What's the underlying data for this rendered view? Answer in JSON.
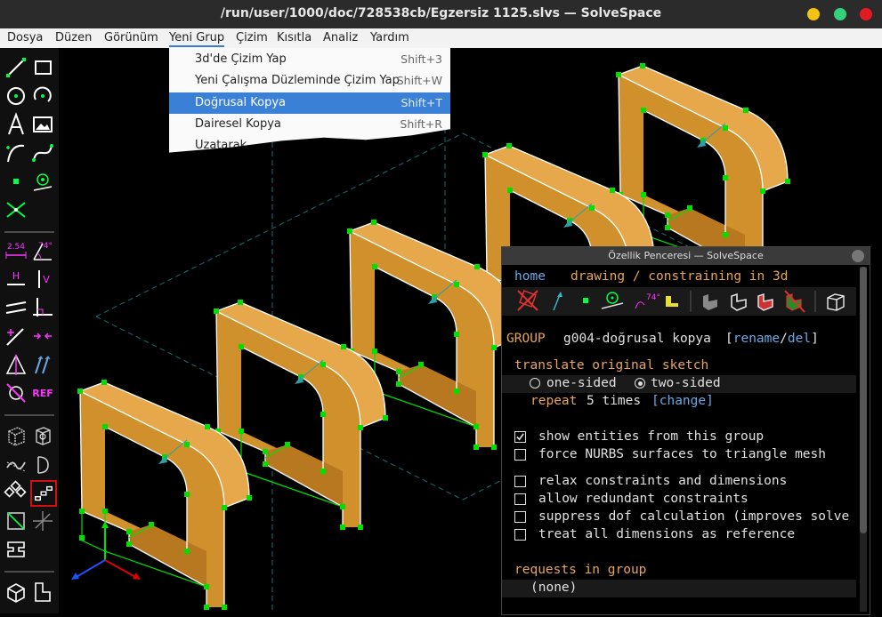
{
  "window": {
    "title": "/run/user/1000/doc/728538cb/Egzersiz 1125.slvs — SolveSpace",
    "colors": {
      "minimize": "#f5c211",
      "maximize": "#33d17a",
      "close": "#e01b24"
    }
  },
  "menubar": {
    "items": [
      {
        "label": "Dosya"
      },
      {
        "label": "Düzen"
      },
      {
        "label": "Görünüm"
      },
      {
        "label": "Yeni Grup"
      },
      {
        "label": "Çizim"
      },
      {
        "label": "Kısıtla"
      },
      {
        "label": "Analiz"
      },
      {
        "label": "Yardım"
      }
    ],
    "active": "Yeni Grup"
  },
  "dropdown": {
    "items": [
      {
        "label": "3d'de Çizim Yap",
        "shortcut": "Shift+3"
      },
      {
        "label": "Yeni Çalışma Düzleminde Çizim Yap",
        "shortcut": "Shift+W"
      },
      {
        "label": "Doğrusal Kopya",
        "shortcut": "Shift+T"
      },
      {
        "label": "Dairesel Kopya",
        "shortcut": "Shift+R"
      },
      {
        "label": "Uzatarak",
        "shortcut": ""
      }
    ],
    "selected": "Doğrusal Kopya"
  },
  "toolbar": {
    "icons": [
      "line-icon",
      "rectangle-icon",
      "circle-icon",
      "arc-icon",
      "text-icon",
      "image-icon",
      "tangent-arc-icon",
      "bezier-icon",
      "point-icon",
      "construction-point-icon",
      "split-curves-icon",
      "distance-icon",
      "angle-icon",
      "horizontal-icon",
      "vertical-icon",
      "parallel-icon",
      "perpendicular-icon",
      "on-point-icon",
      "midpoint-icon",
      "symmetric-icon",
      "equal-icon",
      "ref-icon",
      "extrude-icon",
      "lathe-icon",
      "helix-icon",
      "revolve-icon",
      "step-rotate-icon",
      "step-translate-icon",
      "workplane-icon",
      "dof-icon",
      "assembly-icon",
      "nearest-iso-icon",
      "ortho-icon"
    ],
    "labels": {
      "distance": "2.54",
      "angle": "74°",
      "horizontal": "H",
      "vertical": "V",
      "ref": "REF"
    },
    "accent": "#00ff44",
    "magenta": "#ff33ff"
  },
  "property_browser": {
    "title": "Özellik Penceresi — SolveSpace",
    "nav_home": "home",
    "nav_mode": "drawing / constraining in 3d",
    "group_label": "GROUP",
    "group_name": "g004-doğrusal kopya",
    "rename": "rename",
    "del": "del",
    "translate_title": "translate original sketch",
    "one_sided": "one-sided",
    "two_sided": "two-sided",
    "two_sided_selected": true,
    "repeat_prefix": "repeat",
    "repeat_suffix": "5 times",
    "change": "change",
    "options": [
      {
        "label": "show entities from this group",
        "checked": true
      },
      {
        "label": "force NURBS surfaces to triangle mesh",
        "checked": false
      },
      {
        "label": "relax constraints and dimensions",
        "checked": false
      },
      {
        "label": "allow redundant constraints",
        "checked": false
      },
      {
        "label": "suppress dof calculation (improves solve",
        "checked": false
      },
      {
        "label": "treat all dimensions as reference",
        "checked": false
      }
    ],
    "requests_title": "requests in group",
    "requests_value": "(none)",
    "colors": {
      "link": "#6aa8e8",
      "orange": "#e8a558",
      "text": "#e0e0e0",
      "yellow": "#f0d060"
    }
  },
  "model": {
    "copies": 5,
    "solid_color": "#d0902c",
    "point_color": "#00e000"
  }
}
